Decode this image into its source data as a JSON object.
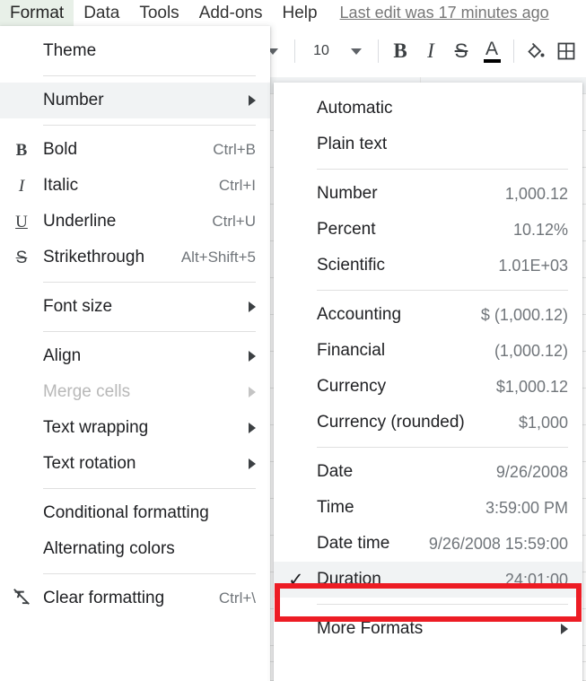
{
  "menubar": {
    "items": [
      {
        "label": "Format",
        "active": true
      },
      {
        "label": "Data",
        "active": false
      },
      {
        "label": "Tools",
        "active": false
      },
      {
        "label": "Add-ons",
        "active": false
      },
      {
        "label": "Help",
        "active": false
      }
    ],
    "last_edit": "Last edit was 17 minutes ago"
  },
  "toolbar": {
    "font_size": "10",
    "bold_glyph": "B",
    "italic_glyph": "I",
    "strikethrough_glyph": "S",
    "text_color_glyph": "A",
    "text_color_swatch": "#000000",
    "fill_color_glyph": "◆",
    "borders_glyph": "⊞"
  },
  "format_menu": {
    "rows": [
      {
        "type": "item",
        "icon": "",
        "label": "Theme",
        "accel": "",
        "arrow": false,
        "highlight": false,
        "disabled": false
      },
      {
        "type": "sep"
      },
      {
        "type": "item",
        "icon": "",
        "label": "Number",
        "accel": "",
        "arrow": true,
        "highlight": true,
        "disabled": false
      },
      {
        "type": "sep"
      },
      {
        "type": "item",
        "icon": "B",
        "label": "Bold",
        "accel": "Ctrl+B",
        "arrow": false,
        "highlight": false,
        "disabled": false
      },
      {
        "type": "item",
        "icon": "I",
        "label": "Italic",
        "accel": "Ctrl+I",
        "arrow": false,
        "highlight": false,
        "disabled": false
      },
      {
        "type": "item",
        "icon": "U",
        "label": "Underline",
        "accel": "Ctrl+U",
        "arrow": false,
        "highlight": false,
        "disabled": false
      },
      {
        "type": "item",
        "icon": "S",
        "label": "Strikethrough",
        "accel": "Alt+Shift+5",
        "arrow": false,
        "highlight": false,
        "disabled": false
      },
      {
        "type": "sep"
      },
      {
        "type": "item",
        "icon": "",
        "label": "Font size",
        "accel": "",
        "arrow": true,
        "highlight": false,
        "disabled": false
      },
      {
        "type": "sep"
      },
      {
        "type": "item",
        "icon": "",
        "label": "Align",
        "accel": "",
        "arrow": true,
        "highlight": false,
        "disabled": false
      },
      {
        "type": "item",
        "icon": "",
        "label": "Merge cells",
        "accel": "",
        "arrow": true,
        "highlight": false,
        "disabled": true
      },
      {
        "type": "item",
        "icon": "",
        "label": "Text wrapping",
        "accel": "",
        "arrow": true,
        "highlight": false,
        "disabled": false
      },
      {
        "type": "item",
        "icon": "",
        "label": "Text rotation",
        "accel": "",
        "arrow": true,
        "highlight": false,
        "disabled": false
      },
      {
        "type": "sep"
      },
      {
        "type": "item",
        "icon": "",
        "label": "Conditional formatting",
        "accel": "",
        "arrow": false,
        "highlight": false,
        "disabled": false
      },
      {
        "type": "item",
        "icon": "",
        "label": "Alternating colors",
        "accel": "",
        "arrow": false,
        "highlight": false,
        "disabled": false
      },
      {
        "type": "sep"
      },
      {
        "type": "item",
        "icon": "clear-formatting-icon",
        "label": "Clear formatting",
        "accel": "Ctrl+\\",
        "arrow": false,
        "highlight": false,
        "disabled": false
      }
    ]
  },
  "number_submenu": {
    "rows": [
      {
        "type": "item",
        "label": "Automatic",
        "sample": "",
        "arrow": false,
        "checked": false,
        "highlight": false
      },
      {
        "type": "item",
        "label": "Plain text",
        "sample": "",
        "arrow": false,
        "checked": false,
        "highlight": false
      },
      {
        "type": "sep"
      },
      {
        "type": "item",
        "label": "Number",
        "sample": "1,000.12",
        "arrow": false,
        "checked": false,
        "highlight": false
      },
      {
        "type": "item",
        "label": "Percent",
        "sample": "10.12%",
        "arrow": false,
        "checked": false,
        "highlight": false
      },
      {
        "type": "item",
        "label": "Scientific",
        "sample": "1.01E+03",
        "arrow": false,
        "checked": false,
        "highlight": false
      },
      {
        "type": "sep"
      },
      {
        "type": "item",
        "label": "Accounting",
        "sample": "$ (1,000.12)",
        "arrow": false,
        "checked": false,
        "highlight": false
      },
      {
        "type": "item",
        "label": "Financial",
        "sample": "(1,000.12)",
        "arrow": false,
        "checked": false,
        "highlight": false
      },
      {
        "type": "item",
        "label": "Currency",
        "sample": "$1,000.12",
        "arrow": false,
        "checked": false,
        "highlight": false
      },
      {
        "type": "item",
        "label": "Currency (rounded)",
        "sample": "$1,000",
        "arrow": false,
        "checked": false,
        "highlight": false
      },
      {
        "type": "sep"
      },
      {
        "type": "item",
        "label": "Date",
        "sample": "9/26/2008",
        "arrow": false,
        "checked": false,
        "highlight": false
      },
      {
        "type": "item",
        "label": "Time",
        "sample": "3:59:00 PM",
        "arrow": false,
        "checked": false,
        "highlight": false
      },
      {
        "type": "item",
        "label": "Date time",
        "sample": "9/26/2008 15:59:00",
        "arrow": false,
        "checked": false,
        "highlight": false
      },
      {
        "type": "item",
        "label": "Duration",
        "sample": "24:01:00",
        "arrow": false,
        "checked": true,
        "highlight": true
      },
      {
        "type": "sep"
      },
      {
        "type": "item",
        "label": "More Formats",
        "sample": "",
        "arrow": true,
        "checked": false,
        "highlight": false
      }
    ]
  },
  "annotation": {
    "color": "#ed1c24",
    "target_label": "Duration"
  }
}
